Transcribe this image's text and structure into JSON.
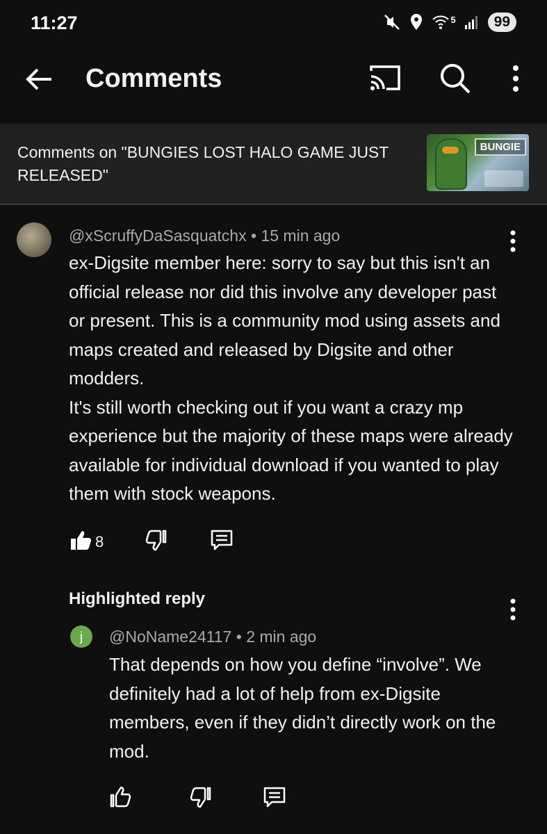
{
  "status_bar": {
    "time": "11:27",
    "network_label": "5",
    "battery": "99"
  },
  "app_bar": {
    "title": "Comments",
    "icons": [
      "back-arrow-icon",
      "cast-icon",
      "search-icon",
      "more-vert-icon"
    ]
  },
  "video": {
    "comments_on": "Comments on \"BUNGIES LOST HALO GAME JUST RELEASED\"",
    "thumbnail_logo": "BUNGIE"
  },
  "comment": {
    "author": "@xScruffyDaSasquatchx",
    "age": "15 min ago",
    "text": "ex-Digsite member here: sorry to say but this isn't an official release nor did this involve any developer past or present. This is a community mod using assets and maps created and released by Digsite and other modders.\nIt's still worth checking out if you want a crazy mp experience but the majority of these maps were already available for individual download if you wanted to play them with stock weapons.",
    "likes": "8",
    "liked": true
  },
  "highlighted_reply": {
    "label": "Highlighted reply",
    "avatar_letter": "j",
    "author": "@NoName24117",
    "age": "2 min ago",
    "text": "That depends on how you define “involve”. We definitely had a lot of help from ex-Digsite members, even if they didn’t directly work on the mod."
  },
  "colors": {
    "background": "#0f0f0f",
    "header_bg": "#212121",
    "meta_text": "#aaaaaa",
    "reply_avatar": "#6aa84f"
  }
}
